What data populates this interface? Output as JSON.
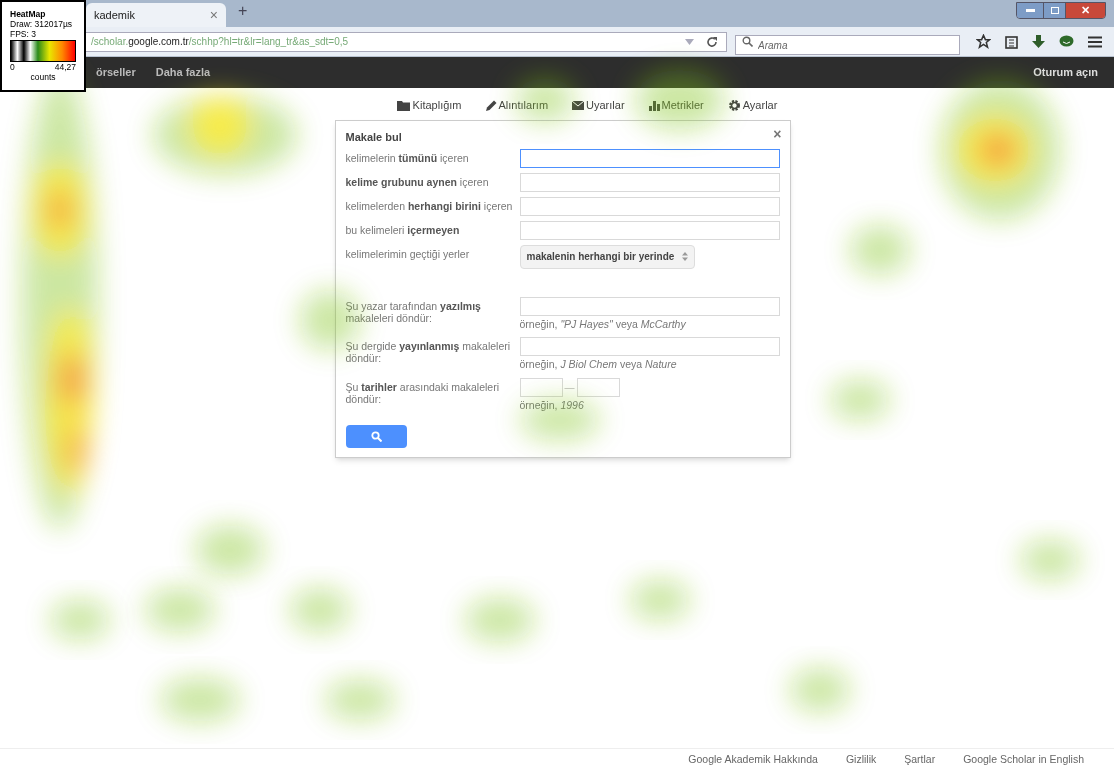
{
  "heatmap_legend": {
    "title": "HeatMap",
    "draw": "Draw: 312017µs",
    "fps": "FPS: 3",
    "min": "0",
    "max": "44,27",
    "unit": "counts"
  },
  "browser": {
    "window_close": "✕",
    "tab_title": "kademik",
    "tab_close": "×",
    "new_tab": "+",
    "url_prefix": "/scholar.",
    "url_domain": "google.com.tr",
    "url_path": "/schhp?hl=tr&lr=lang_tr&as_sdt=0,5",
    "search_placeholder": "Arama"
  },
  "top_bar": {
    "links": [
      "örseller",
      "Daha fazla"
    ],
    "sign_in": "Oturum açın"
  },
  "menu": [
    {
      "kind": "folder",
      "label": "Kitaplığım"
    },
    {
      "kind": "pencil",
      "label": "Alıntılarım"
    },
    {
      "kind": "mail",
      "label": "Uyarılar"
    },
    {
      "kind": "chart",
      "label": "Metrikler"
    },
    {
      "kind": "gear",
      "label": "Ayarlar"
    }
  ],
  "dialog": {
    "title": "Makale bul",
    "close": "×",
    "rows": [
      {
        "kind": "text",
        "label": "kelimelerin **tümünü** içeren",
        "focused": true
      },
      {
        "kind": "text",
        "label": "**kelime grubunu aynen** içeren",
        "focused": false
      },
      {
        "kind": "text",
        "label": "kelimelerden **herhangi birini** içeren",
        "focused": false
      },
      {
        "kind": "text",
        "label": "bu kelimeleri **içermeyen**",
        "focused": false
      },
      {
        "kind": "select",
        "label": "kelimelerimin geçtiği yerler",
        "value": "makalenin herhangi bir yerinde"
      },
      {
        "kind": "text",
        "label": "Şu yazar tarafından **yazılmış** makaleleri döndür:",
        "hint": "örneğin, *\"PJ Hayes\"* veya *McCarthy*",
        "focused": false
      },
      {
        "kind": "text",
        "label": "Şu dergide **yayınlanmış** makaleleri döndür:",
        "hint": "örneğin, *J Biol Chem* veya *Nature*",
        "focused": false
      },
      {
        "kind": "date_range",
        "label": "Şu **tarihler** arasındaki makaleleri döndür:",
        "separator": "—",
        "hint": "örneğin, *1996*"
      }
    ]
  },
  "footer": [
    "Google Akademik Hakkında",
    "Gizlilik",
    "Şartlar",
    "Google Scholar in English"
  ]
}
